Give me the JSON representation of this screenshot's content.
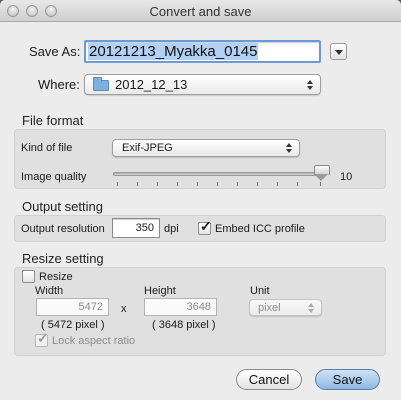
{
  "window": {
    "title": "Convert and save"
  },
  "save_as": {
    "label": "Save As:",
    "value": "20121213_Myakka_0145"
  },
  "where": {
    "label": "Where:",
    "value": "2012_12_13"
  },
  "file_format": {
    "title": "File format",
    "kind_label": "Kind of file",
    "kind_value": "Exif-JPEG",
    "quality_label": "Image quality",
    "quality_value": "10",
    "quality_level": 10
  },
  "output_setting": {
    "title": "Output setting",
    "resolution_label": "Output resolution",
    "resolution_value": "350",
    "resolution_unit": "dpi",
    "embed_icc_label": "Embed ICC profile",
    "embed_icc_checked": true
  },
  "resize_setting": {
    "title": "Resize setting",
    "resize_label": "Resize",
    "resize_checked": false,
    "width_label": "Width",
    "width_value": "5472",
    "width_pixel_note": "( 5472 pixel )",
    "times": "x",
    "height_label": "Height",
    "height_value": "3648",
    "height_pixel_note": "( 3648 pixel )",
    "unit_label": "Unit",
    "unit_value": "pixel",
    "lock_label": "Lock aspect ratio",
    "lock_checked": true
  },
  "buttons": {
    "cancel": "Cancel",
    "save": "Save"
  }
}
